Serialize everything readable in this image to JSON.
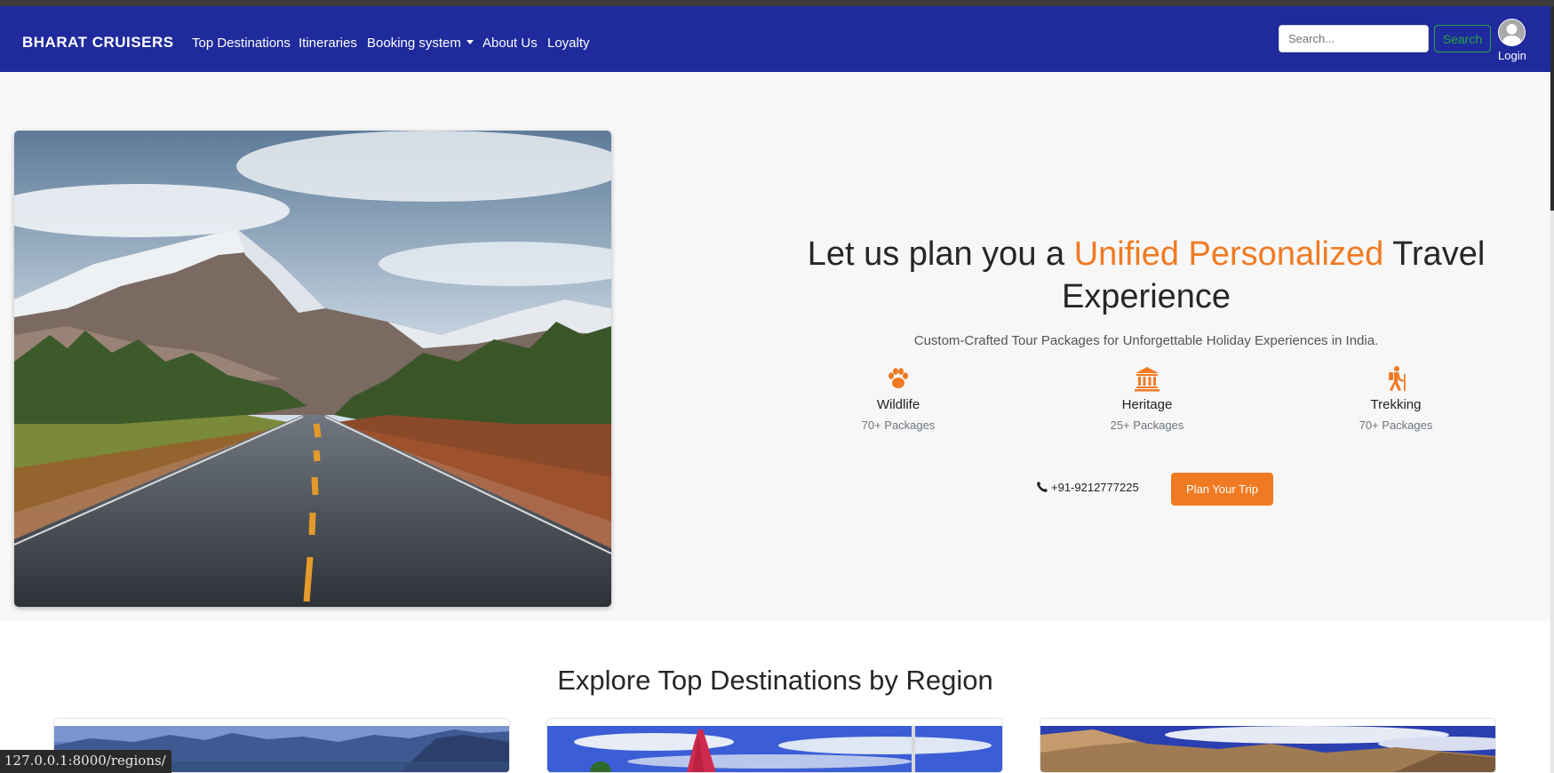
{
  "status_url": "127.0.0.1:8000/regions/",
  "navbar": {
    "brand": "BHARAT CRUISERS",
    "links": {
      "top_destinations": "Top Destinations",
      "itineraries": "Itineraries",
      "booking_system": "Booking system",
      "about_us": "About Us",
      "loyalty": "Loyalty"
    },
    "search_placeholder": "Search...",
    "search_button": "Search",
    "login": "Login"
  },
  "hero": {
    "title_prefix": "Let us plan you a ",
    "title_accent": "Unified Personalized",
    "title_suffix": " Travel Experience",
    "subtitle": "Custom-Crafted Tour Packages for Unforgettable Holiday Experiences in India.",
    "features": [
      {
        "icon": "paw-icon",
        "title": "Wildlife",
        "count": "70+ Packages"
      },
      {
        "icon": "heritage-icon",
        "title": "Heritage",
        "count": "25+ Packages"
      },
      {
        "icon": "hiking-icon",
        "title": "Trekking",
        "count": "70+ Packages"
      }
    ],
    "phone": "+91-9212777225",
    "cta": "Plan Your Trip"
  },
  "regions": {
    "title": "Explore Top Destinations by Region"
  },
  "colors": {
    "navbar": "#1f2a9c",
    "accent": "#f07a22",
    "search_outline": "#28a745",
    "hero_bg": "#f7f7f7"
  }
}
